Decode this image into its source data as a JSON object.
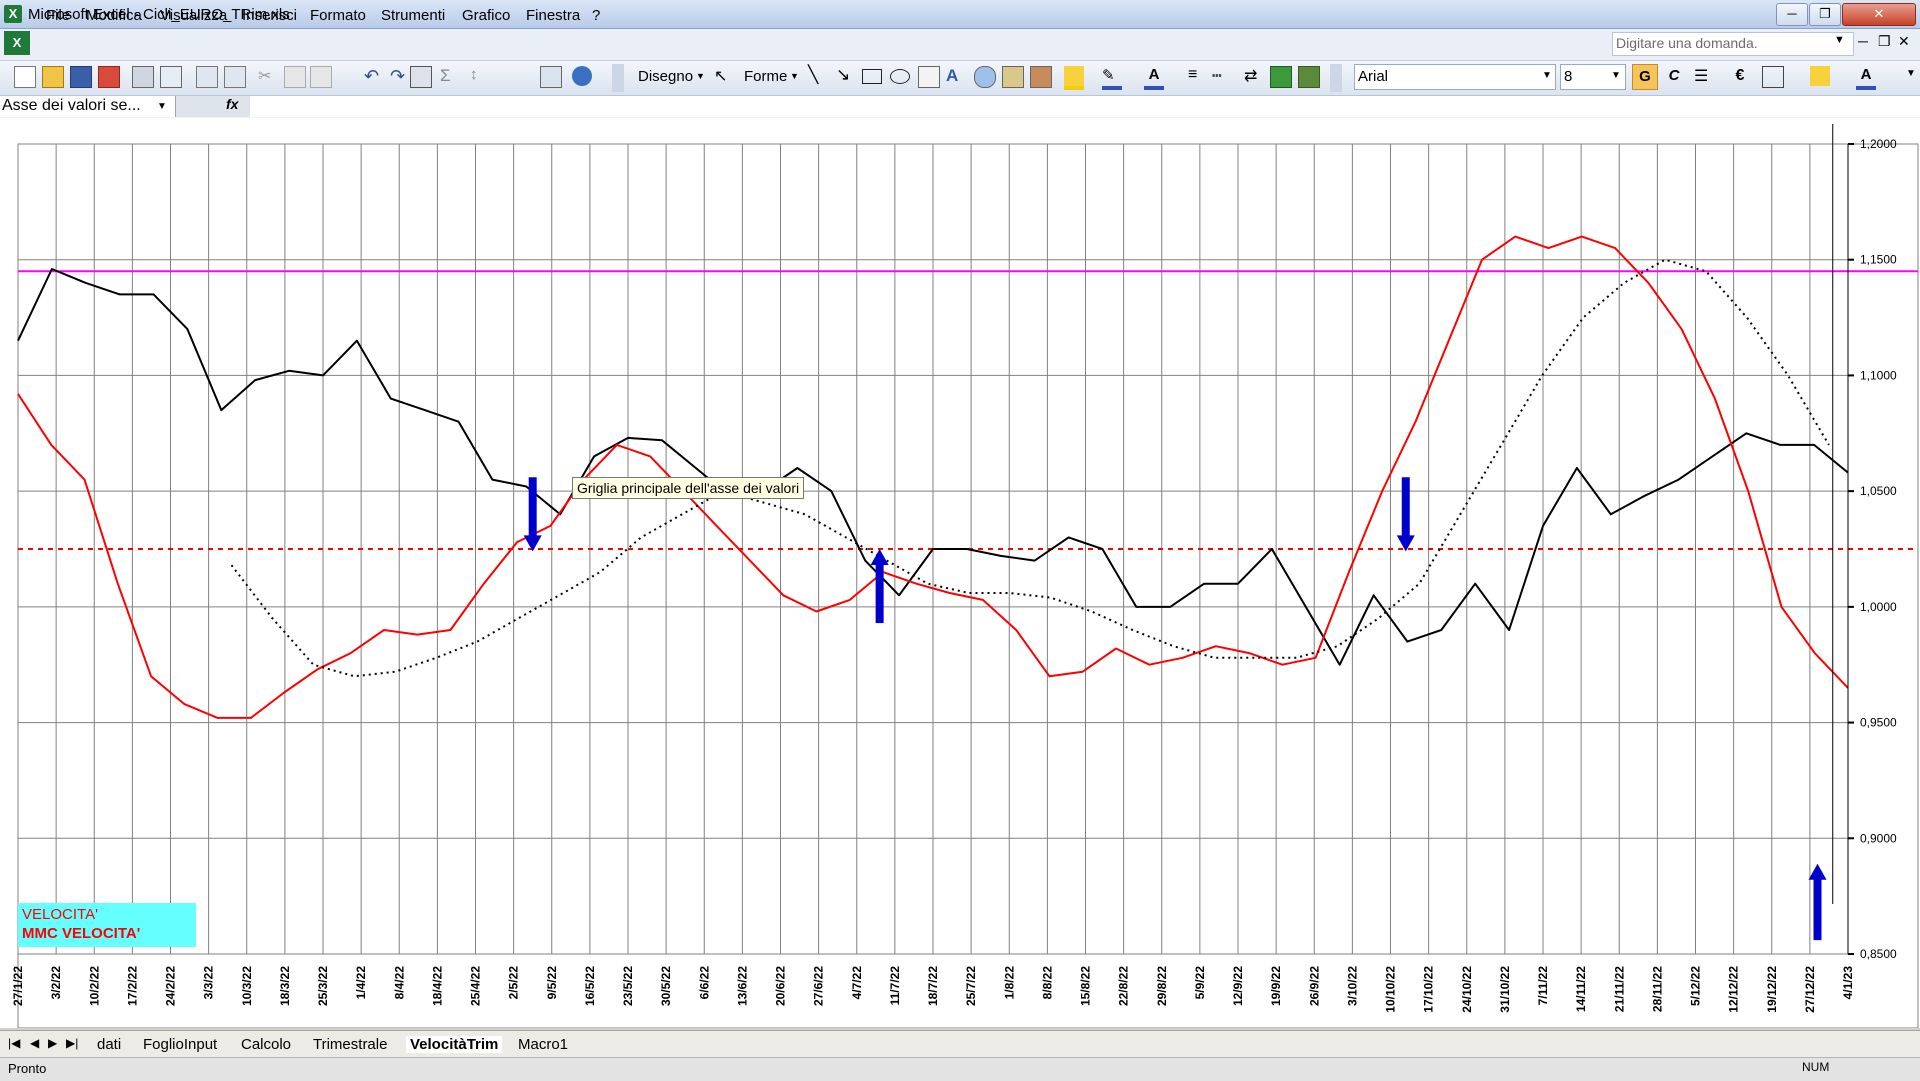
{
  "window": {
    "title": "Microsoft Excel - Cicli_EURO_TRim.xls",
    "app_icon": "excel-icon",
    "controls": {
      "minimize": "─",
      "restore": "❐",
      "close": "✕"
    }
  },
  "menu": {
    "items": [
      "File",
      "Modifica",
      "Visualizza",
      "Inserisci",
      "Formato",
      "Strumenti",
      "Grafico",
      "Finestra",
      "?"
    ],
    "help_placeholder": "Digitare una domanda.",
    "doc_controls": [
      "─",
      "❐",
      "✕"
    ]
  },
  "toolbar": {
    "draw_label": "Disegno",
    "shapes_label": "Forme",
    "font_name": "Arial",
    "font_size": "8",
    "bold": "G",
    "italic": "C",
    "euro": "€"
  },
  "formula_bar": {
    "name_box": "Asse dei valori se...",
    "fx": "fx"
  },
  "tooltip": "Griglia principale dell'asse dei valori",
  "legend": {
    "line1": "VELOCITA'",
    "line2": "MMC VELOCITA'"
  },
  "sheet_tabs": [
    "dati",
    "FoglioInput",
    "Calcolo",
    "Trimestrale",
    "VelocitàTrim",
    "Macro1"
  ],
  "active_tab": "VelocitàTrim",
  "status": {
    "left": "Pronto",
    "right": "NUM"
  },
  "chart_data": {
    "type": "line",
    "ylim": [
      0.85,
      1.2
    ],
    "y_ticks": [
      "1,2000",
      "1,1500",
      "1,1000",
      "1,0500",
      "1,0000",
      "0,9500",
      "0,9000",
      "0,8500"
    ],
    "x_labels": [
      "27/1/22",
      "3/2/22",
      "10/2/22",
      "17/2/22",
      "24/2/22",
      "3/3/22",
      "10/3/22",
      "18/3/22",
      "25/3/22",
      "1/4/22",
      "8/4/22",
      "18/4/22",
      "25/4/22",
      "2/5/22",
      "9/5/22",
      "16/5/22",
      "23/5/22",
      "30/5/22",
      "6/6/22",
      "13/6/22",
      "20/6/22",
      "27/6/22",
      "4/7/22",
      "11/7/22",
      "18/7/22",
      "25/7/22",
      "1/8/22",
      "8/8/22",
      "15/8/22",
      "22/8/22",
      "29/8/22",
      "5/9/22",
      "12/9/22",
      "19/9/22",
      "26/9/22",
      "3/10/22",
      "10/10/22",
      "17/10/22",
      "24/10/22",
      "31/10/22",
      "7/11/22",
      "14/11/22",
      "21/11/22",
      "28/11/22",
      "5/12/22",
      "12/12/22",
      "19/12/22",
      "27/12/22",
      "4/1/23"
    ],
    "horizontal_lines": [
      {
        "value": 1.145,
        "color": "#ff00ff",
        "style": "solid"
      },
      {
        "value": 1.025,
        "color": "#ff0000",
        "style": "dashed"
      }
    ],
    "series": [
      {
        "color": "#000000",
        "style": "solid",
        "width": 2,
        "values": [
          1.115,
          1.146,
          1.14,
          1.135,
          1.135,
          1.12,
          1.085,
          1.098,
          1.102,
          1.1,
          1.115,
          1.09,
          1.085,
          1.08,
          1.055,
          1.052,
          1.04,
          1.065,
          1.073,
          1.072,
          1.06,
          1.048,
          1.05,
          1.06,
          1.05,
          1.02,
          1.005,
          1.025,
          1.025,
          1.022,
          1.02,
          1.03,
          1.025,
          1.0,
          1.0,
          1.01,
          1.01,
          1.025,
          1.0,
          0.975,
          1.005,
          0.985,
          0.99,
          1.01,
          0.99,
          1.035,
          1.06,
          1.04,
          1.048,
          1.055,
          1.065,
          1.075,
          1.07,
          1.07,
          1.058
        ]
      },
      {
        "color": "#ff0000",
        "style": "solid",
        "width": 2,
        "values": [
          1.092,
          1.07,
          1.055,
          1.01,
          0.97,
          0.958,
          0.952,
          0.952,
          0.963,
          0.973,
          0.98,
          0.99,
          0.988,
          0.99,
          1.01,
          1.028,
          1.035,
          1.055,
          1.07,
          1.065,
          1.05,
          1.035,
          1.02,
          1.005,
          0.998,
          1.003,
          1.015,
          1.01,
          1.006,
          1.003,
          0.99,
          0.97,
          0.972,
          0.982,
          0.975,
          0.978,
          0.983,
          0.98,
          0.975,
          0.978,
          1.015,
          1.05,
          1.08,
          1.115,
          1.15,
          1.16,
          1.155,
          1.16,
          1.155,
          1.14,
          1.12,
          1.09,
          1.05,
          1.0,
          0.98,
          0.965
        ]
      },
      {
        "color": "#000000",
        "style": "dotted",
        "width": 2,
        "values": [
          1.018,
          0.995,
          0.975,
          0.97,
          0.972,
          0.978,
          0.985,
          0.995,
          1.005,
          1.015,
          1.03,
          1.04,
          1.05,
          1.045,
          1.04,
          1.03,
          1.02,
          1.01,
          1.006,
          1.006,
          1.004,
          0.998,
          0.99,
          0.983,
          0.978,
          0.978,
          0.978,
          0.983,
          0.995,
          1.01,
          1.04,
          1.07,
          1.1,
          1.125,
          1.14,
          1.15,
          1.145,
          1.125,
          1.1,
          1.07
        ]
      }
    ],
    "arrows": [
      {
        "x_index": 13.5,
        "from": 1.056,
        "to": 1.024,
        "direction": "down"
      },
      {
        "x_index": 22.6,
        "from": 0.993,
        "to": 1.025,
        "direction": "up"
      },
      {
        "x_index": 36.4,
        "from": 1.056,
        "to": 1.024,
        "direction": "down"
      },
      {
        "x_index": 47.2,
        "from": 0.856,
        "to": 0.889,
        "direction": "up"
      }
    ],
    "cursor_x_index": 47.6
  }
}
